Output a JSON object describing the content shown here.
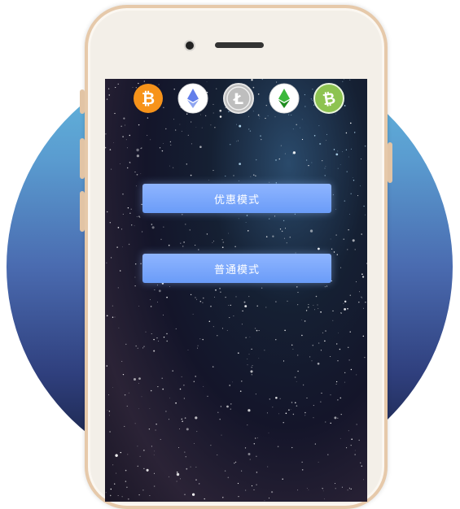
{
  "coins": [
    {
      "name": "bitcoin",
      "symbol": "₿",
      "bg": "#f7931a",
      "fg": "#ffffff"
    },
    {
      "name": "ethereum",
      "symbol": "",
      "bg": "#ffffff",
      "fg": "#627eea"
    },
    {
      "name": "litecoin",
      "symbol": "Ł",
      "bg": "#bebebe",
      "fg": "#ffffff"
    },
    {
      "name": "ethereum-classic",
      "symbol": "",
      "bg": "#ffffff",
      "fg": "#3ab83a"
    },
    {
      "name": "bitcoin-cash",
      "symbol": "₿",
      "bg": "#8dc351",
      "fg": "#ffffff"
    }
  ],
  "buttons": {
    "discount_mode": "优惠模式",
    "normal_mode": "普通模式"
  },
  "colors": {
    "button_accent": "#7aa8ff",
    "phone_frame": "#e6c9aa"
  }
}
